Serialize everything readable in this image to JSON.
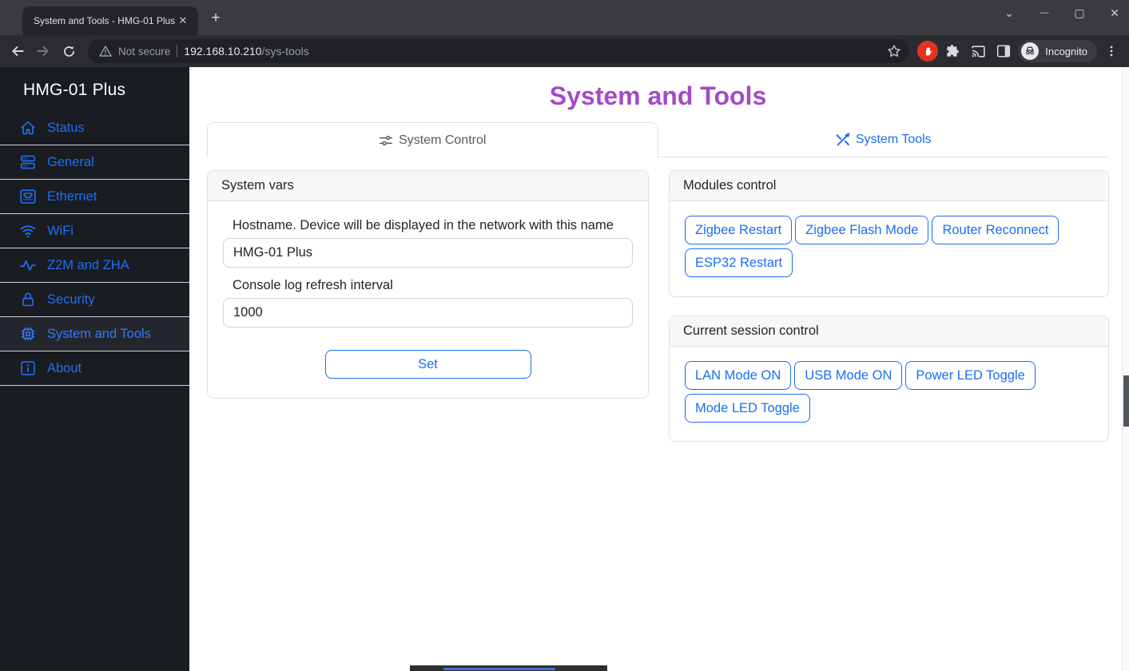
{
  "browser": {
    "tab_title": "System and Tools - HMG-01 Plus",
    "new_tab": "+",
    "close_tab": "✕",
    "window": {
      "chevron": "⌄",
      "minimize": "—",
      "maximize": "▢",
      "close": "✕"
    },
    "security_label": "Not secure",
    "url_host": "192.168.10.210",
    "url_path": "/sys-tools",
    "incognito_label": "Incognito",
    "icons": [
      "back-arrow",
      "forward-arrow",
      "reload",
      "warning-triangle",
      "bookmark-star",
      "adblock-hand",
      "extensions-puzzle",
      "cast",
      "side-panel",
      "incognito",
      "menu-kebab"
    ]
  },
  "sidebar": {
    "brand": "HMG-01 Plus",
    "items": [
      {
        "label": "Status",
        "icon": "home-icon",
        "active": false
      },
      {
        "label": "General",
        "icon": "server-icon",
        "active": false
      },
      {
        "label": "Ethernet",
        "icon": "ethernet-icon",
        "active": false
      },
      {
        "label": "WiFi",
        "icon": "wifi-icon",
        "active": false
      },
      {
        "label": "Z2M and ZHA",
        "icon": "activity-icon",
        "active": false
      },
      {
        "label": "Security",
        "icon": "lock-icon",
        "active": false
      },
      {
        "label": "System and Tools",
        "icon": "cpu-icon",
        "active": true
      },
      {
        "label": "About",
        "icon": "info-icon",
        "active": false
      }
    ]
  },
  "main": {
    "page_title": "System and Tools",
    "tabs": [
      {
        "label": "System Control",
        "icon": "sliders-icon",
        "active": true
      },
      {
        "label": "System Tools",
        "icon": "tools-icon",
        "active": false
      }
    ],
    "system_vars": {
      "title": "System vars",
      "hostname_label": "Hostname. Device will be displayed in the network with this name",
      "hostname_value": "HMG-01 Plus",
      "interval_label": "Console log refresh interval",
      "interval_value": "1000",
      "set_button": "Set"
    },
    "modules_control": {
      "title": "Modules control",
      "buttons": [
        "Zigbee Restart",
        "Zigbee Flash Mode",
        "Router Reconnect",
        "ESP32 Restart"
      ]
    },
    "session_control": {
      "title": "Current session control",
      "buttons": [
        "LAN Mode ON",
        "USB Mode ON",
        "Power LED Toggle",
        "Mode LED Toggle"
      ]
    }
  },
  "colors": {
    "accent_blue": "#1b6ef3",
    "sidebar_link_blue": "#1f6ff2",
    "title_purple": "#a44bc8",
    "adblock_red": "#e13222",
    "sidebar_bg": "#191c20",
    "chrome_frame": "#3a3b3e",
    "chrome_toolbar": "#2b2c2f"
  }
}
